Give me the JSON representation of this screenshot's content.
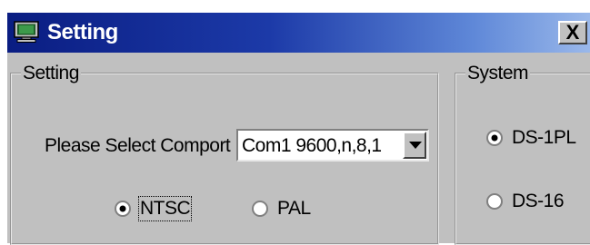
{
  "window": {
    "title": "Setting",
    "close_label": "X"
  },
  "setting_group": {
    "legend": "Setting",
    "comport_label": "Please Select Comport",
    "comport_value": "Com1 9600,n,8,1",
    "radios": [
      {
        "label": "NTSC",
        "selected": true
      },
      {
        "label": "PAL",
        "selected": false
      }
    ]
  },
  "system_group": {
    "legend": "System",
    "radios": [
      {
        "label": "DS-1PL",
        "selected": true
      },
      {
        "label": "DS-16",
        "selected": false
      }
    ]
  },
  "icons": {
    "app": "computer-monitor-icon",
    "dropdown": "chevron-down-icon",
    "close": "close-icon"
  }
}
